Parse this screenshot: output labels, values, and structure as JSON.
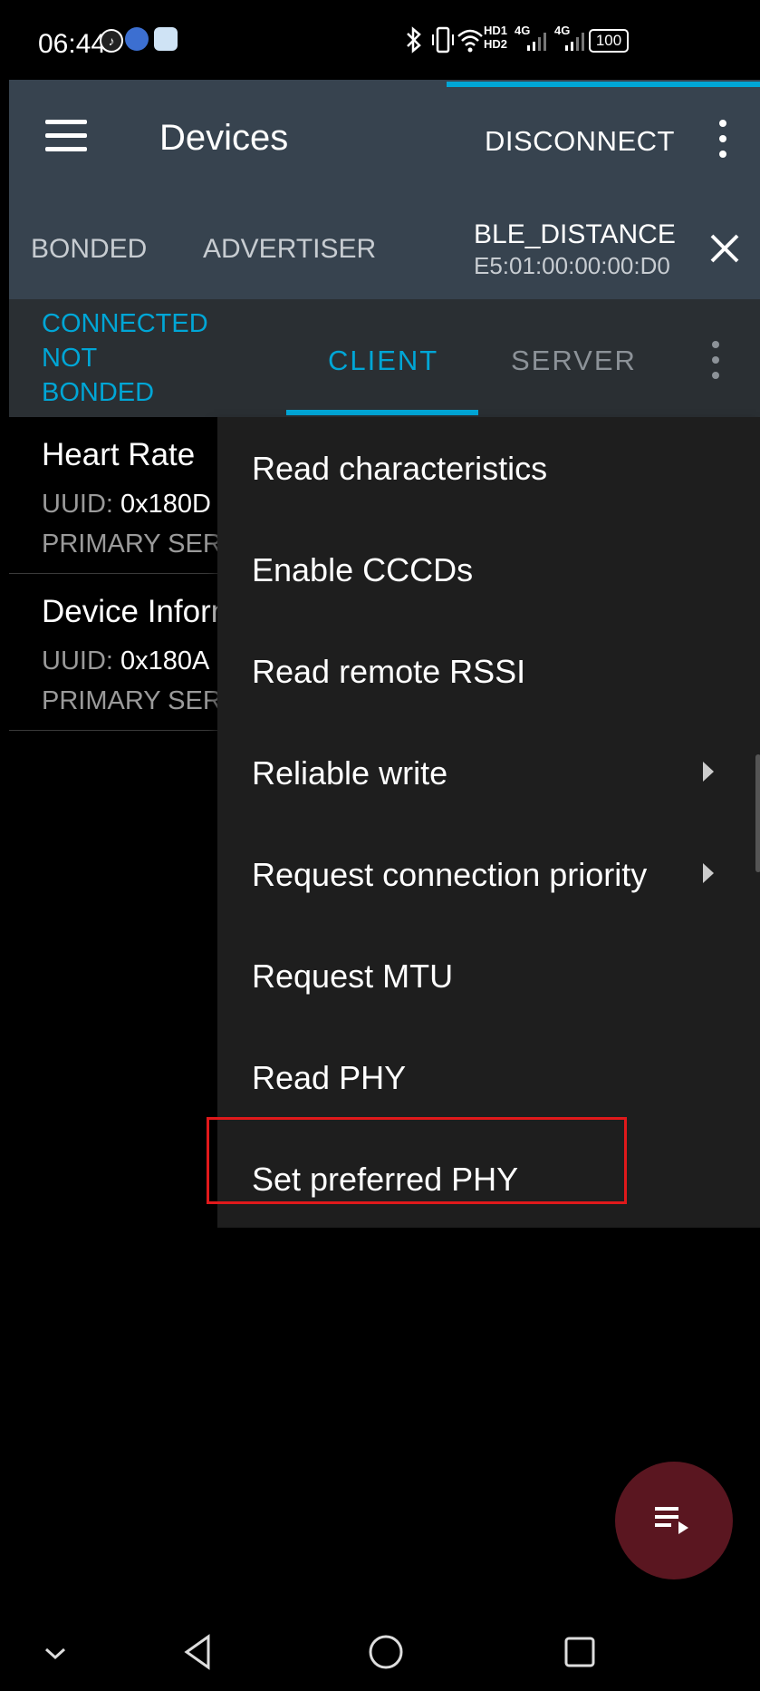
{
  "status_bar": {
    "time": "06:44",
    "icons": [
      "tiktok-icon",
      "app-icon",
      "app-icon",
      "bluetooth-icon",
      "vibrate-icon",
      "wifi-icon",
      "hd-icon",
      "signal-4g-icon",
      "signal-4g-icon",
      "battery-icon"
    ],
    "hd1": "HD1",
    "hd2": "HD2",
    "net1": "4G",
    "net2": "4G",
    "battery": "100"
  },
  "app_bar": {
    "title": "Devices",
    "action": "DISCONNECT"
  },
  "device_tabs": {
    "bonded": "BONDED",
    "advertiser": "ADVERTISER",
    "device_name": "BLE_DISTANCE",
    "device_address": "E5:01:00:00:00:D0"
  },
  "connection": {
    "state": "CONNECTED",
    "bond_line1": "NOT",
    "bond_line2": "BONDED",
    "tab_client": "CLIENT",
    "tab_server": "SERVER"
  },
  "services": [
    {
      "name": "Heart Rate",
      "uuid_label": "UUID:",
      "uuid": "0x180D",
      "type": "PRIMARY SERVICE"
    },
    {
      "name": "Device Information",
      "uuid_label": "UUID:",
      "uuid": "0x180A",
      "type": "PRIMARY SERVICE"
    }
  ],
  "menu": {
    "items": [
      {
        "label": "Read characteristics",
        "submenu": false
      },
      {
        "label": "Enable CCCDs",
        "submenu": false
      },
      {
        "label": "Read remote RSSI",
        "submenu": false
      },
      {
        "label": "Reliable write",
        "submenu": true
      },
      {
        "label": "Request connection priority",
        "submenu": true
      },
      {
        "label": "Request MTU",
        "submenu": false
      },
      {
        "label": "Read PHY",
        "submenu": false
      },
      {
        "label": "Set preferred PHY",
        "submenu": false
      }
    ],
    "highlighted_item": "Set preferred PHY"
  },
  "colors": {
    "accent": "#00a6d6",
    "app_bar": "#37434f",
    "highlight": "#e0191b",
    "fab": "#5a1620"
  },
  "nav_bar": [
    "chevron-down-icon",
    "back-icon",
    "home-icon",
    "recents-icon"
  ]
}
